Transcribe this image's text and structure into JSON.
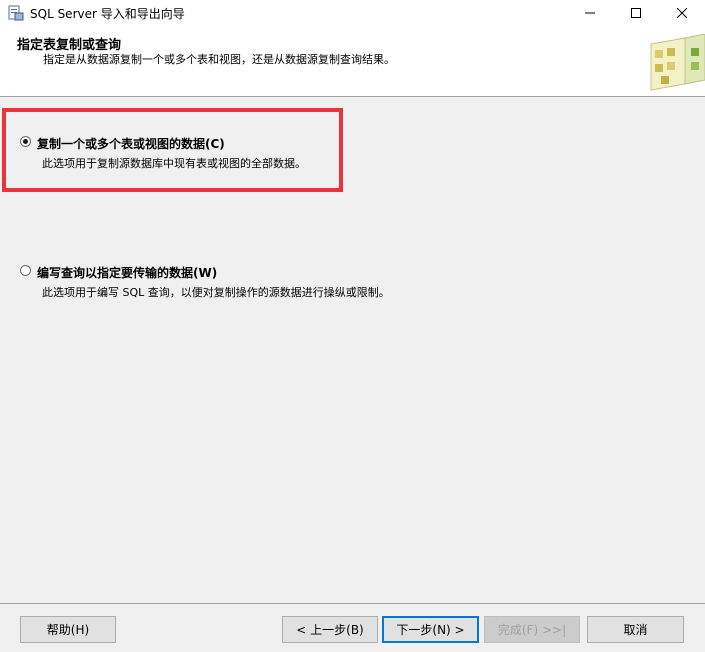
{
  "window": {
    "title": "SQL Server 导入和导出向导",
    "minimize_glyph": "—",
    "maximize_glyph": "☐",
    "close_glyph": "✕"
  },
  "header": {
    "title": "指定表复制或查询",
    "subtitle": "指定是从数据源复制一个或多个表和视图，还是从数据源复制查询结果。"
  },
  "options": [
    {
      "label": "复制一个或多个表或视图的数据(C)",
      "description": "此选项用于复制源数据库中现有表或视图的全部数据。",
      "selected": true
    },
    {
      "label": "编写查询以指定要传输的数据(W)",
      "description": "此选项用于编写 SQL 查询，以便对复制操作的源数据进行操纵或限制。",
      "selected": false
    }
  ],
  "footer": {
    "help": "帮助(H)",
    "back": "< 上一步(B)",
    "next": "下一步(N) >",
    "finish": "完成(F) >>|",
    "cancel": "取消"
  },
  "colors": {
    "highlight": "#e8343b",
    "default_button_border": "#0078d7"
  }
}
